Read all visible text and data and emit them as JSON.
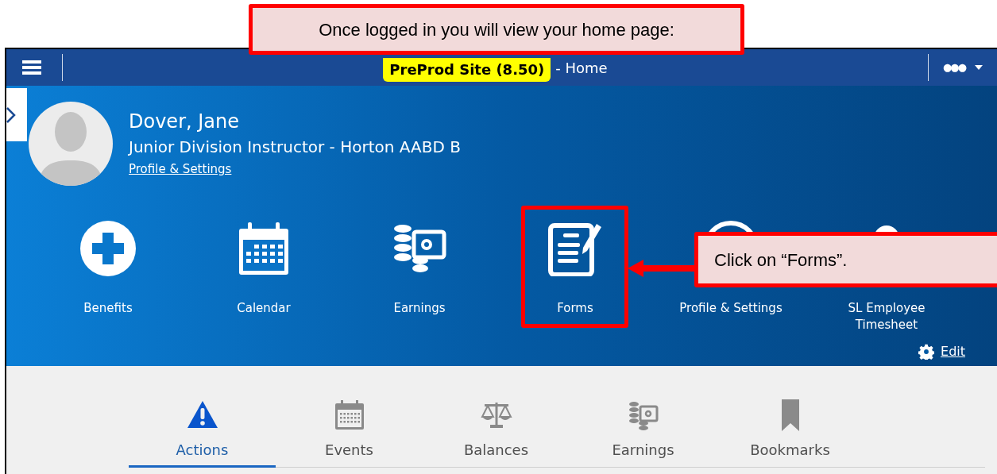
{
  "header": {
    "badge": "PreProd Site (8.50)",
    "title": "- Home",
    "menu_glyph": "●●●"
  },
  "profile": {
    "name": "Dover, Jane",
    "position": "Junior Division Instructor - Horton AABD B",
    "link": "Profile & Settings"
  },
  "tiles": [
    {
      "label": "Benefits"
    },
    {
      "label": "Calendar"
    },
    {
      "label": "Earnings"
    },
    {
      "label": "Forms",
      "highlighted": true
    },
    {
      "label": "Profile & Settings"
    },
    {
      "label": "SL Employee Timesheet"
    }
  ],
  "edit_link": "Edit",
  "tabs": [
    {
      "label": "Actions",
      "selected": true
    },
    {
      "label": "Events",
      "selected": false
    },
    {
      "label": "Balances",
      "selected": false
    },
    {
      "label": "Earnings",
      "selected": false
    },
    {
      "label": "Bookmarks",
      "selected": false
    }
  ],
  "annotations": [
    {
      "text": "Once logged in you will view your home page:"
    },
    {
      "text": "Click on “Forms”."
    }
  ]
}
